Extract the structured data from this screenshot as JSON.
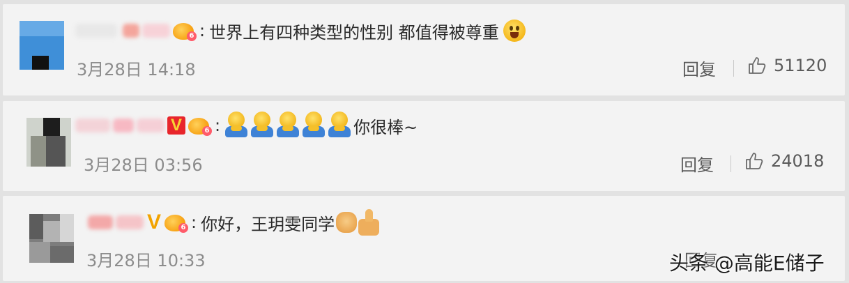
{
  "comments": [
    {
      "text": "世界上有四种类型的性别 都值得被尊重",
      "time": "3月28日 14:18",
      "reply_label": "回复",
      "likes": "51120",
      "badge_level": "6"
    },
    {
      "text": "你很棒~",
      "time": "3月28日 03:56",
      "reply_label": "回复",
      "likes": "24018",
      "badge_v": "V",
      "badge_level": "6"
    },
    {
      "text": "你好，王玥雯同学",
      "time": "3月28日 10:33",
      "reply_label": "回复",
      "badge_v": "V",
      "badge_level": "6"
    }
  ],
  "separator_colon": ":",
  "watermark": "头条 @高能E储子",
  "colors": {
    "page_bg": "#e2e2e2",
    "card_bg": "#f3f3f3",
    "text": "#2a2a2a",
    "muted": "#8c8c8c",
    "vip_red": "#e8252b",
    "vip_gold": "#f2a300"
  },
  "icons": [
    "crown-level-badge-icon",
    "vip-v-icon",
    "scream-emoji-icon",
    "hug-emoji-icon",
    "handshake-emoji-icon",
    "thumbs-up-emoji-icon",
    "like-thumb-icon"
  ]
}
